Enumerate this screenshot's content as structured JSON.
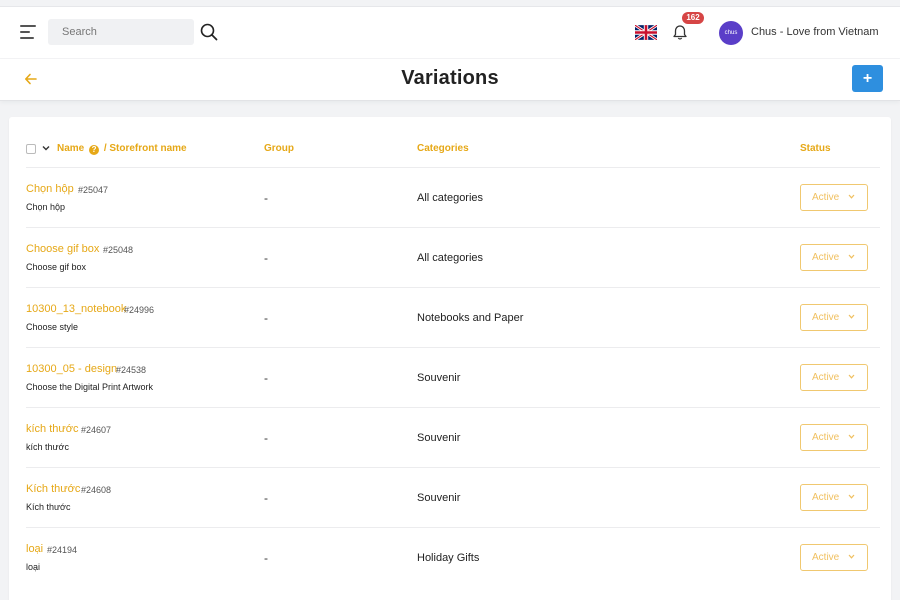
{
  "header": {
    "search_placeholder": "Search",
    "notification_count": "162",
    "avatar_text": "chus",
    "store_name": "Chus - Love from Vietnam"
  },
  "page": {
    "title": "Variations",
    "add_label": "+"
  },
  "table": {
    "columns": {
      "name": "Name",
      "separator": "/",
      "storefront": "Storefront name",
      "group": "Group",
      "categories": "Categories",
      "status": "Status"
    },
    "rows": [
      {
        "name": "Chọn hộp",
        "id": "#25047",
        "storefront": "Chọn hộp",
        "group": "-",
        "category": "All categories",
        "status": "Active"
      },
      {
        "name": "Choose gif box",
        "id": "#25048",
        "storefront": "Choose gif box",
        "group": "-",
        "category": "All categories",
        "status": "Active"
      },
      {
        "name": "10300_13_notebook",
        "id": "#24996",
        "storefront": "Choose style",
        "group": "-",
        "category": "Notebooks and Paper",
        "status": "Active"
      },
      {
        "name": "10300_05 - design",
        "id": "#24538",
        "storefront": "Choose the Digital Print Artwork",
        "group": "-",
        "category": "Souvenir",
        "status": "Active"
      },
      {
        "name": "kích thước",
        "id": "#24607",
        "storefront": "kích thước",
        "group": "-",
        "category": "Souvenir",
        "status": "Active"
      },
      {
        "name": "Kích thước",
        "id": "#24608",
        "storefront": "Kích thước",
        "group": "-",
        "category": "Souvenir",
        "status": "Active"
      },
      {
        "name": "loại",
        "id": "#24194",
        "storefront": "loại",
        "group": "-",
        "category": "Holiday Gifts",
        "status": "Active"
      }
    ]
  },
  "colors": {
    "accent": "#e6a817",
    "primary_button": "#2e8fdf",
    "badge": "#d64545",
    "avatar": "#5a3ec8"
  }
}
